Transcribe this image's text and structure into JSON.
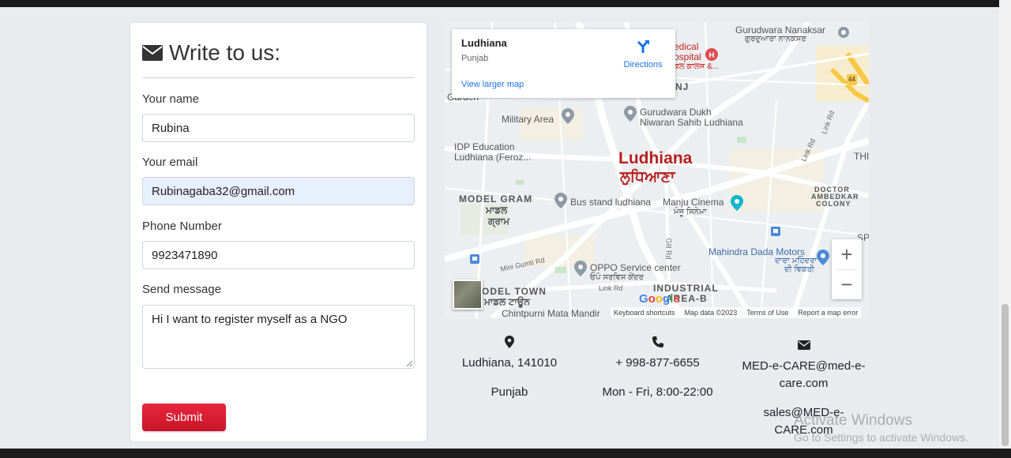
{
  "form": {
    "title": "Write to us:",
    "name_label": "Your name",
    "name_value": "Rubina",
    "email_label": "Your email",
    "email_value": "Rubinagaba32@gmail.com",
    "phone_label": "Phone Number",
    "phone_value": "9923471890",
    "message_label": "Send message",
    "message_value": "Hi I want to register myself as a NGO",
    "submit_label": "Submit"
  },
  "map": {
    "place_name": "Ludhiana",
    "place_region": "Punjab",
    "directions_label": "Directions",
    "larger_map_label": "View larger map",
    "labels": {
      "city": "Ludhiana",
      "city_local": "ਲੁਧਿਆਣਾ",
      "gurudwara_nanaksar": "Gurudwara Nanaksar",
      "gurudwara_nanaksar_local": "ਗੁਰਦੁਆਰਾ ਨਾਨਕਸਰ",
      "medical_hospital": "edical",
      "medical_hospital2": "ospital",
      "medical_hospital_local": "ਕਲ ਕਾਲਜ &...",
      "military_area": "Military Area",
      "gurudwara_dukh": "Gurudwara Dukh",
      "gurudwara_dukh2": "Niwaran Sahib Ludhiana",
      "idp": "IDP Education",
      "idp2": "Ludhiana (Feroz...",
      "model_gram": "MODEL GRAM",
      "model_gram_local": "ਮਾਡਲ",
      "model_gram_local2": "ਗ੍ਰਾਮ",
      "bus_stand": "Bus stand ludhiana",
      "manju_cinema": "Manju Cinema",
      "manju_cinema_local": "ਮੰਜੂ ਸਿਨੇਮਾ",
      "doctor_ambedkar": "DOCTOR",
      "doctor_ambedkar2": "AMBEDKAR",
      "doctor_ambedkar3": "COLONY",
      "mahindra": "Mahindra Dada Motors",
      "mahindra_local": "ਦਾਦਾ ਮਹਿੰਦਰਾ",
      "mahindra_local2": "ਦੀ ਵਿਕਰੀ",
      "oppo": "OPPO Service center",
      "oppo_local": "ਓਪੋ ਸਰਵਿਸ ਕੇਂਦਰ",
      "model_town": "ODEL TOWN",
      "model_town_local": "ਮਾਡਲ ਟਾਊਨ",
      "industrial": "INDUSTRIAL",
      "industrial2": "AREA-B",
      "chintpurni": "Chintpurni Mata Mandir",
      "garden": "Garden",
      "nj": "NJ",
      "thi": "THI",
      "sp": "SP",
      "road_44": "44",
      "link_rd": "Link Rd",
      "link_rd2": "Link Rd",
      "link_rd3": "Link Rd",
      "gill_rd": "Gill Rd",
      "mini_gumti": "Mini Gumti Rd"
    },
    "attribution": {
      "logo": "Google",
      "shortcuts": "Keyboard shortcuts",
      "map_data": "Map data ©2023",
      "terms": "Terms of Use",
      "report": "Report a map error"
    },
    "zoom_in": "+",
    "zoom_out": "−"
  },
  "contact": {
    "address_line1": "Ludhiana, 141010",
    "address_line2": "Punjab",
    "phone": "+ 998-877-6655",
    "hours": "Mon - Fri, 8:00-22:00",
    "email1_line1": "MED-e-CARE@med-e-",
    "email1_line2": "care.com",
    "email2_line1": "sales@MED-e-",
    "email2_line2": "CARE.com"
  },
  "watermark": {
    "title": "Activate Windows",
    "subtitle": "Go to Settings to activate Windows."
  },
  "colors": {
    "accent": "#dc1f35",
    "link": "#1a73e8",
    "city_label": "#b8201f"
  },
  "icons": [
    "envelope-icon",
    "map-pin-icon",
    "phone-icon",
    "directions-icon"
  ]
}
